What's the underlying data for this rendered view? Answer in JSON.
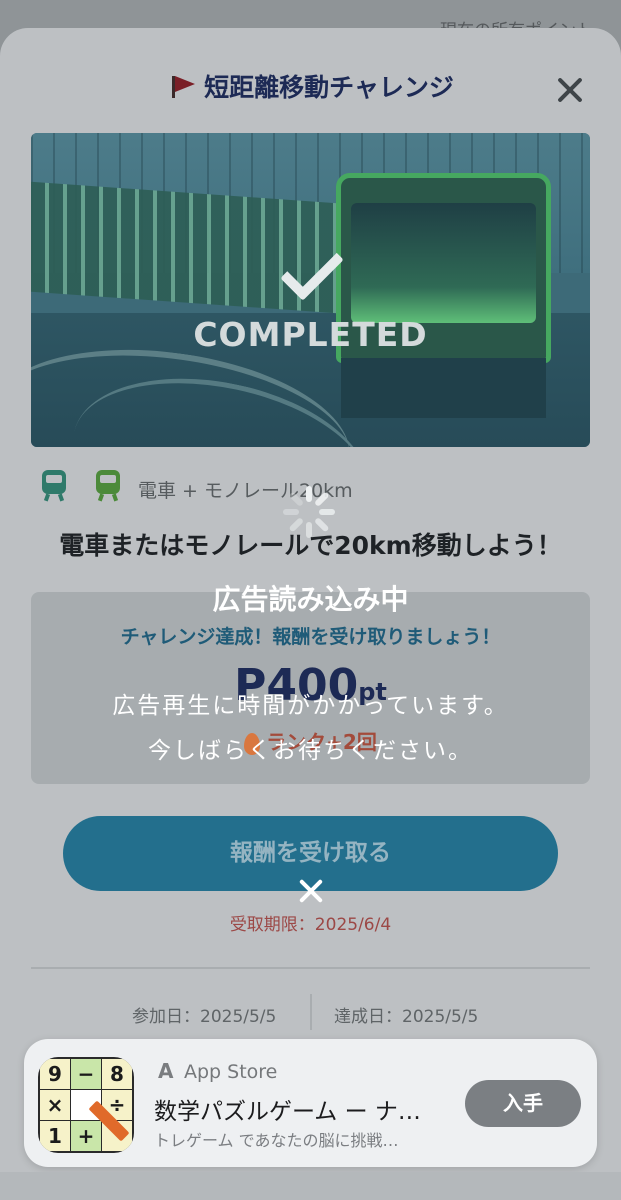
{
  "background_app": {
    "points_label": "現在の所有ポイント"
  },
  "sheet": {
    "title": "短距離移動チャレンジ",
    "hero": {
      "completed_label": "COMPLETED"
    },
    "route": {
      "label": "電車 + モノレール20km"
    },
    "challenge_description": "電車またはモノレールで20km移動しよう！",
    "reward": {
      "message": "チャレンジ達成！報酬を受け取りましょう！",
      "points_prefix": "P",
      "points_value": "400",
      "points_unit": "pt",
      "bonus_label": "ランク+2回"
    },
    "receive_button_label": "報酬を受け取る",
    "deadline": "受取期限：2025/6/4",
    "join_date": "参加日：2025/5/5",
    "completed_date": "達成日：2025/5/5"
  },
  "loading_overlay": {
    "title": "広告読み込み中",
    "line1": "広告再生に時間がかかっています。",
    "line2": "今しばらくお待ちください。"
  },
  "ad_banner": {
    "store_label": "App Store",
    "app_title": "数学パズルゲーム ー ナ…",
    "app_subtitle": "トレゲーム であなたの脳に挑戦…",
    "get_button_label": "入手",
    "icon_cells": [
      "9",
      "−",
      "8",
      "×",
      "÷",
      "1",
      "+"
    ]
  },
  "colors": {
    "title": "#1d2a55",
    "accent_button": "#236f8d",
    "reward_message": "#1f5b78",
    "deadline": "#9c4846",
    "train_icon_teal": "#2f7a6a",
    "train_icon_green": "#4c8a3a"
  }
}
